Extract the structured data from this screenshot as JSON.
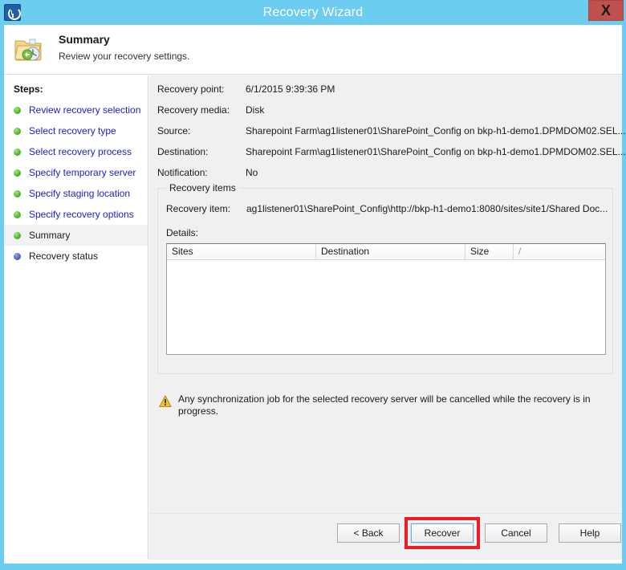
{
  "window": {
    "title": "Recovery Wizard",
    "title_icon": "recovery-clock-icon",
    "close_label": "X",
    "accent_color": "#6ccdf0",
    "close_color": "#c0504d"
  },
  "header": {
    "icon": "folder-recovery-icon",
    "title": "Summary",
    "subtitle": "Review your recovery settings."
  },
  "sidebar": {
    "label": "Steps:",
    "items": [
      {
        "label": "Review recovery selection",
        "state": "done"
      },
      {
        "label": "Select recovery type",
        "state": "done"
      },
      {
        "label": "Select recovery process",
        "state": "done"
      },
      {
        "label": "Specify temporary server",
        "state": "done"
      },
      {
        "label": "Specify staging location",
        "state": "done"
      },
      {
        "label": "Specify recovery options",
        "state": "done"
      },
      {
        "label": "Summary",
        "state": "current"
      },
      {
        "label": "Recovery status",
        "state": "pending"
      }
    ]
  },
  "summary": {
    "fields": [
      {
        "label": "Recovery point:",
        "value": "6/1/2015 9:39:36 PM"
      },
      {
        "label": "Recovery media:",
        "value": "Disk"
      },
      {
        "label": "Source:",
        "value": "Sharepoint Farm\\ag1listener01\\SharePoint_Config on bkp-h1-demo1.DPMDOM02.SEL..."
      },
      {
        "label": "Destination:",
        "value": "Sharepoint Farm\\ag1listener01\\SharePoint_Config on bkp-h1-demo1.DPMDOM02.SEL..."
      },
      {
        "label": "Notification:",
        "value": "No"
      }
    ]
  },
  "recovery_items": {
    "legend": "Recovery items",
    "item_label": "Recovery item:",
    "item_value": "ag1listener01\\SharePoint_Config\\http://bkp-h1-demo1:8080/sites/site1/Shared Doc...",
    "details_label": "Details:",
    "columns": [
      "Sites",
      "Destination",
      "Size",
      "/"
    ],
    "rows": []
  },
  "warning": {
    "icon": "warning-triangle-icon",
    "text": "Any synchronization job for the selected recovery server will be cancelled while the recovery is in progress."
  },
  "footer": {
    "back_label": "< Back",
    "recover_label": "Recover",
    "cancel_label": "Cancel",
    "help_label": "Help",
    "highlight_color": "#ee1c25"
  }
}
